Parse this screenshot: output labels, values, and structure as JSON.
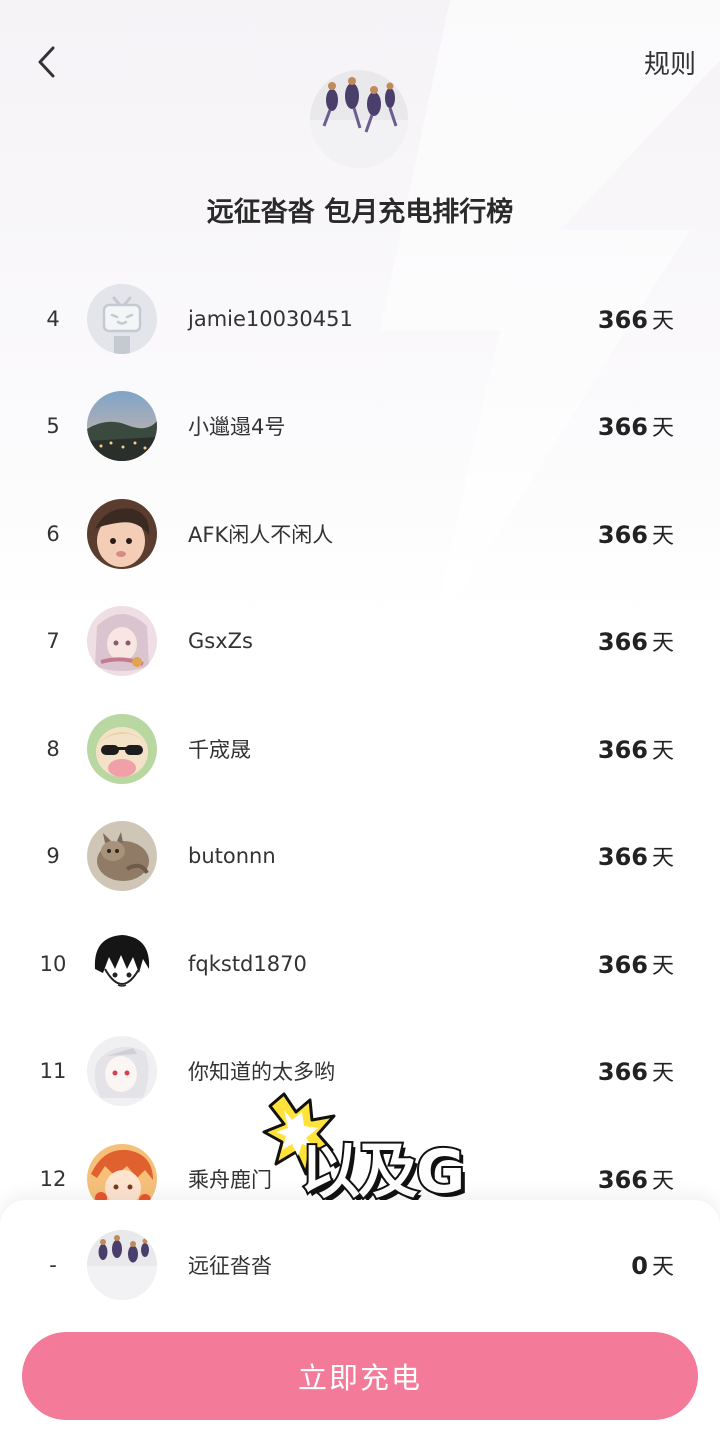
{
  "header": {
    "back_icon": "chevron-left-icon",
    "rules_label": "规则",
    "title": "远征沓沓 包月充电排行榜"
  },
  "ranking": [
    {
      "rank": "4",
      "name": "jamie10030451",
      "days": "366",
      "unit": "天"
    },
    {
      "rank": "5",
      "name": "小邋遢4号",
      "days": "366",
      "unit": "天"
    },
    {
      "rank": "6",
      "name": "AFK闲人不闲人",
      "days": "366",
      "unit": "天"
    },
    {
      "rank": "7",
      "name": "GsxZs",
      "days": "366",
      "unit": "天"
    },
    {
      "rank": "8",
      "name": "千宬晟",
      "days": "366",
      "unit": "天"
    },
    {
      "rank": "9",
      "name": "butonnn",
      "days": "366",
      "unit": "天"
    },
    {
      "rank": "10",
      "name": "fqkstd1870",
      "days": "366",
      "unit": "天"
    },
    {
      "rank": "11",
      "name": "你知道的太多哟",
      "days": "366",
      "unit": "天"
    },
    {
      "rank": "12",
      "name": "乘舟鹿门",
      "days": "366",
      "unit": "天"
    }
  ],
  "my_entry": {
    "rank": "-",
    "name": "远征沓沓",
    "days": "0",
    "unit": "天"
  },
  "charge_button_label": "立即充电",
  "video_overlay_text": "以及G",
  "colors": {
    "accent": "#f47a9a",
    "text": "#222222"
  }
}
